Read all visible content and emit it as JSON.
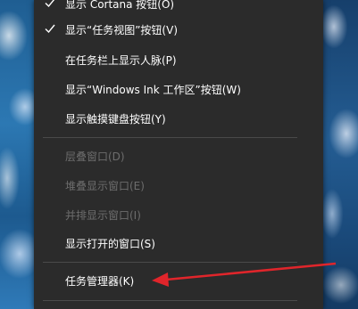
{
  "menu": {
    "items": [
      {
        "label": "显示 Cortana 按钮(O)",
        "checked": true,
        "disabled": false
      },
      {
        "label": "显示“任务视图”按钮(V)",
        "checked": true,
        "disabled": false
      },
      {
        "label": "在任务栏上显示人脉(P)",
        "checked": false,
        "disabled": false
      },
      {
        "label": "显示“Windows Ink 工作区”按钮(W)",
        "checked": false,
        "disabled": false
      },
      {
        "label": "显示触摸键盘按钮(Y)",
        "checked": false,
        "disabled": false
      },
      {
        "label": "层叠窗口(D)",
        "checked": false,
        "disabled": true
      },
      {
        "label": "堆叠显示窗口(E)",
        "checked": false,
        "disabled": true
      },
      {
        "label": "并排显示窗口(I)",
        "checked": false,
        "disabled": true
      },
      {
        "label": "显示打开的窗口(S)",
        "checked": false,
        "disabled": false
      },
      {
        "label": "任务管理器(K)",
        "checked": false,
        "disabled": false
      }
    ]
  },
  "colors": {
    "menu_bg": "#2b2b2b",
    "text": "#ffffff",
    "disabled_text": "#6d6d6d",
    "separator": "#4a4a4a",
    "arrow": "#e0252b"
  },
  "icons": {
    "check": "check-icon",
    "annotation": "red-arrow-icon"
  }
}
